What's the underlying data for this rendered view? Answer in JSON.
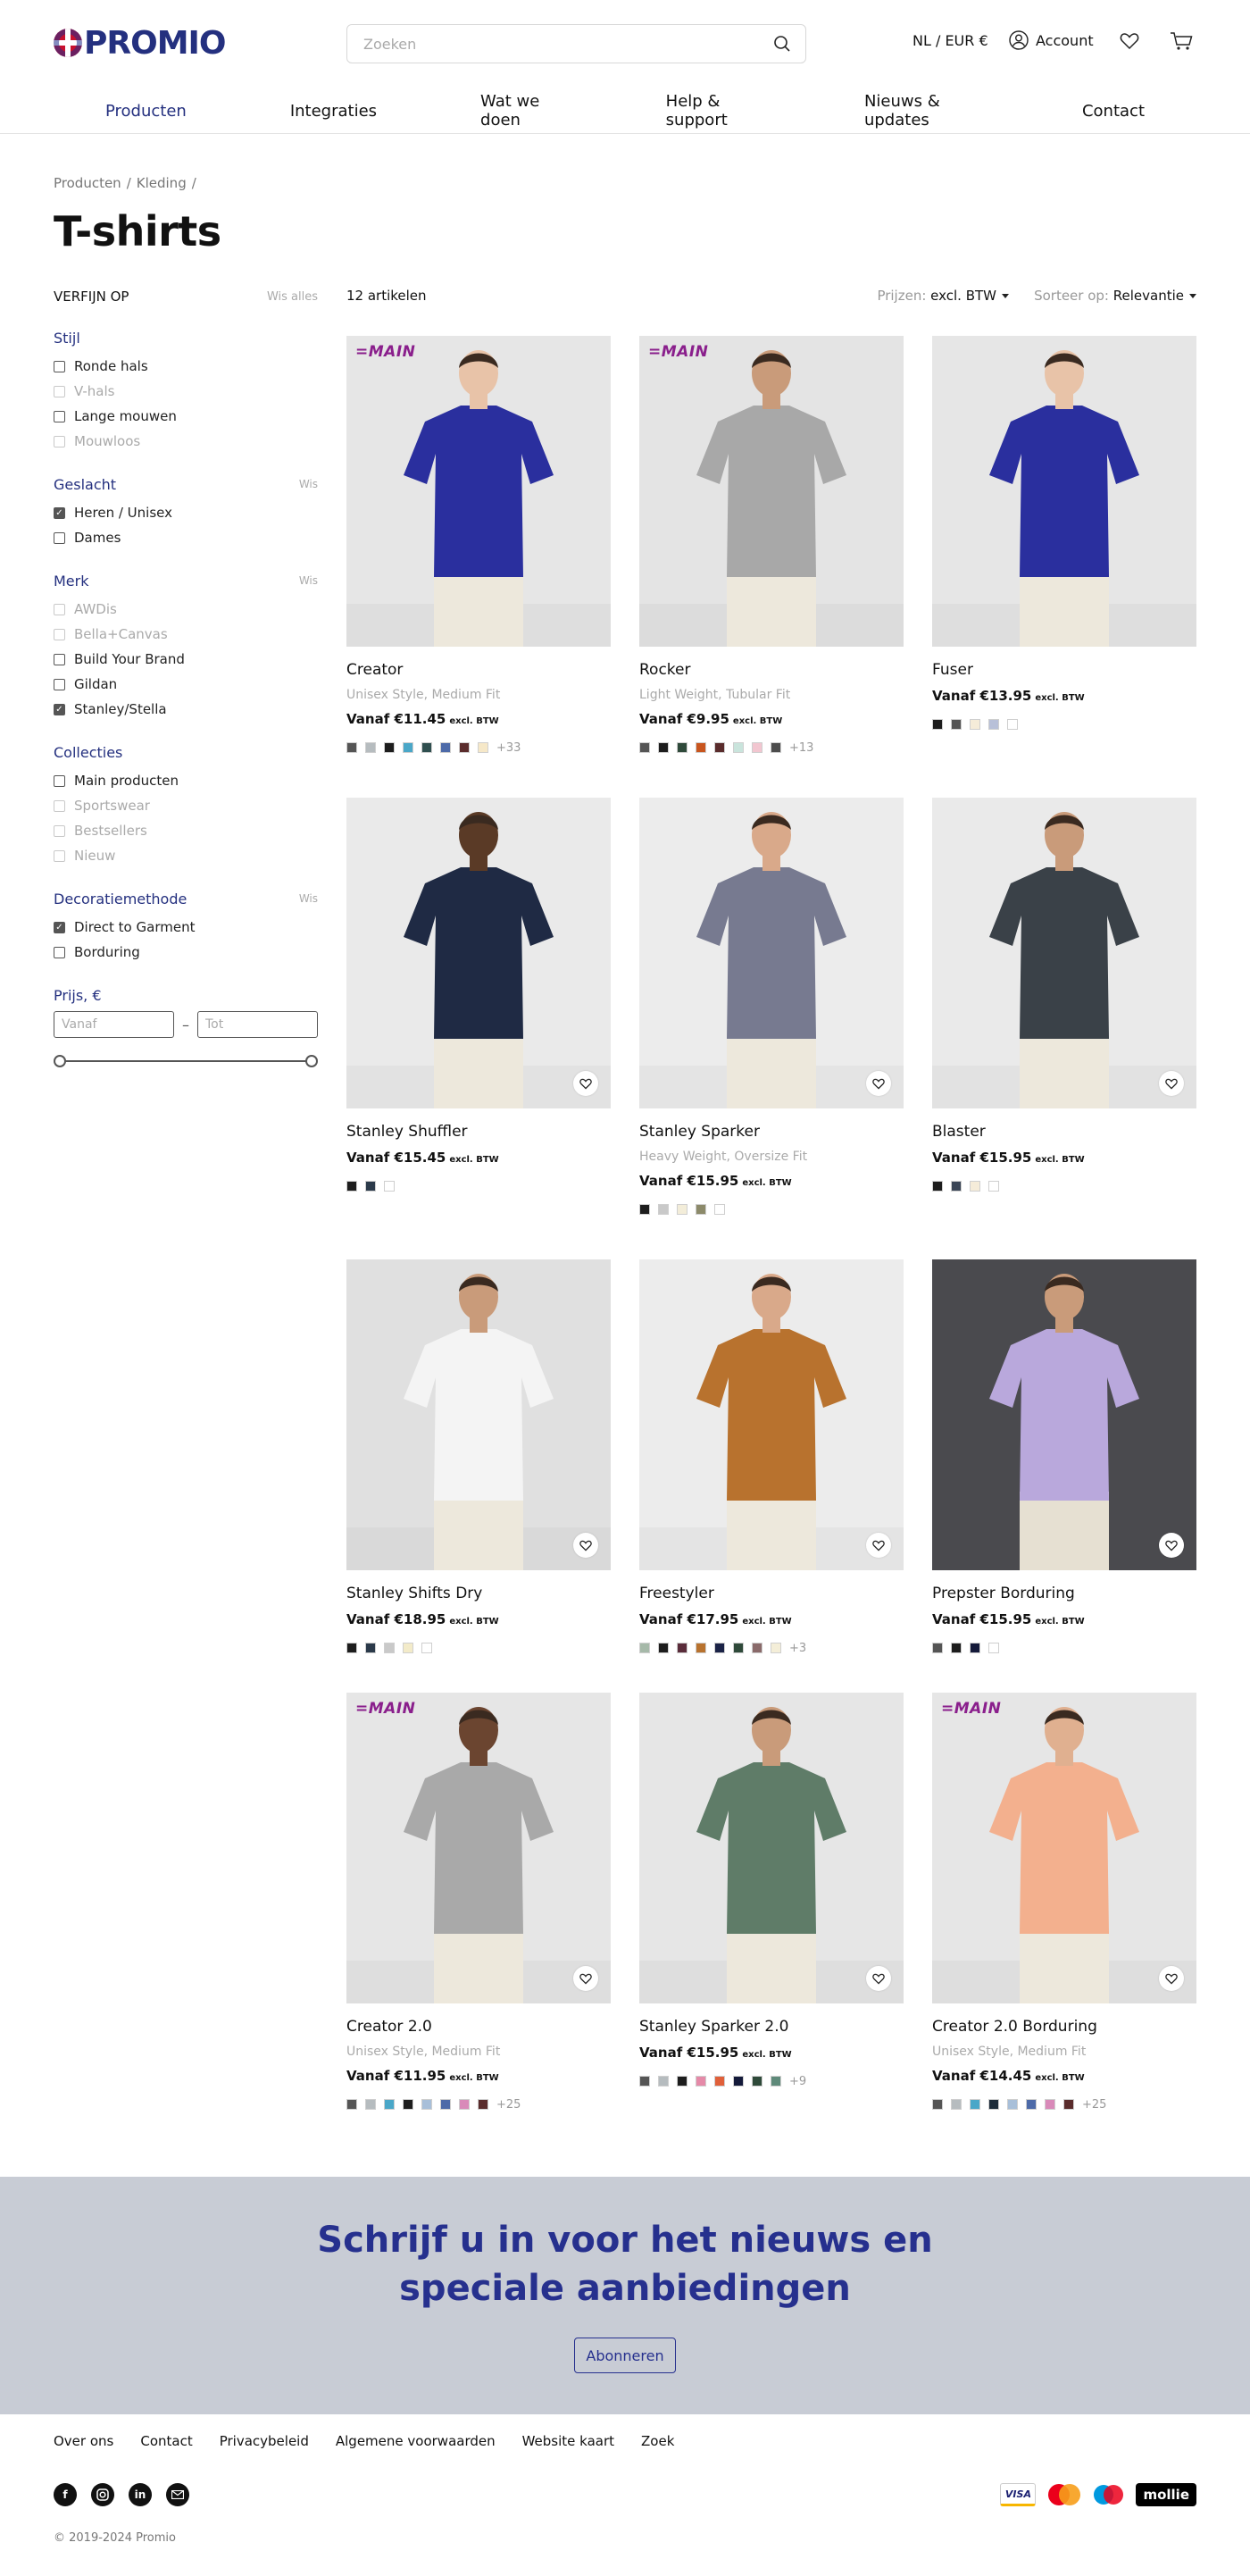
{
  "header": {
    "logo_text": "PROMIO",
    "search_placeholder": "Zoeken",
    "locale": "NL / EUR €",
    "account": "Account"
  },
  "nav": [
    "Producten",
    "Integraties",
    "Wat we doen",
    "Help & support",
    "Nieuws & updates",
    "Contact"
  ],
  "breadcrumb": [
    "Producten",
    "/",
    "Kleding",
    "/"
  ],
  "page_title": "T-shirts",
  "sidebar": {
    "heading": "VERFIJN OP",
    "clear_all": "Wis alles",
    "groups": [
      {
        "title": "Stijl",
        "clear": "",
        "options": [
          {
            "label": "Ronde hals",
            "checked": false,
            "disabled": false
          },
          {
            "label": "V-hals",
            "checked": false,
            "disabled": true
          },
          {
            "label": "Lange mouwen",
            "checked": false,
            "disabled": false
          },
          {
            "label": "Mouwloos",
            "checked": false,
            "disabled": true
          }
        ]
      },
      {
        "title": "Geslacht",
        "clear": "Wis",
        "options": [
          {
            "label": "Heren / Unisex",
            "checked": true,
            "disabled": false
          },
          {
            "label": "Dames",
            "checked": false,
            "disabled": false
          }
        ]
      },
      {
        "title": "Merk",
        "clear": "Wis",
        "options": [
          {
            "label": "AWDis",
            "checked": false,
            "disabled": true
          },
          {
            "label": "Bella+Canvas",
            "checked": false,
            "disabled": true
          },
          {
            "label": "Build Your Brand",
            "checked": false,
            "disabled": false
          },
          {
            "label": "Gildan",
            "checked": false,
            "disabled": false
          },
          {
            "label": "Stanley/Stella",
            "checked": true,
            "disabled": false
          }
        ]
      },
      {
        "title": "Collecties",
        "clear": "",
        "options": [
          {
            "label": "Main producten",
            "checked": false,
            "disabled": false
          },
          {
            "label": "Sportswear",
            "checked": false,
            "disabled": true
          },
          {
            "label": "Bestsellers",
            "checked": false,
            "disabled": true
          },
          {
            "label": "Nieuw",
            "checked": false,
            "disabled": true
          }
        ]
      },
      {
        "title": "Decoratiemethode",
        "clear": "Wis",
        "options": [
          {
            "label": "Direct to Garment",
            "checked": true,
            "disabled": false
          },
          {
            "label": "Borduring",
            "checked": false,
            "disabled": false
          }
        ]
      }
    ],
    "price": {
      "title": "Prijs, €",
      "from_placeholder": "Vanaf",
      "to_placeholder": "Tot",
      "dash": "–"
    }
  },
  "toolbar": {
    "count": "12 artikelen",
    "prices_label": "Prijzen:",
    "prices_value": "excl. BTW",
    "sort_label": "Sorteer op:",
    "sort_value": "Relevantie"
  },
  "products": [
    {
      "name": "Creator",
      "subtitle": "Unisex Style, Medium Fit",
      "price": "Vanaf €11.45",
      "tax": "excl. BTW",
      "badge": "=MAIN",
      "heart": false,
      "shirt": "#2a2f9e",
      "bg": "#e6e6e6",
      "skin": "#e8c3a8",
      "swatches": [
        "#555555",
        "#b6bcbf",
        "#1d1d1d",
        "#4aa7c8",
        "#2f4f4f",
        "#4d6aa8",
        "#5a2c2c",
        "#f6e8c8"
      ],
      "more": "+33"
    },
    {
      "name": "Rocker",
      "subtitle": "Light Weight, Tubular Fit",
      "price": "Vanaf €9.95",
      "tax": "excl. BTW",
      "badge": "=MAIN",
      "heart": false,
      "shirt": "#a8a8a8",
      "bg": "#e4e4e4",
      "skin": "#c99b7a",
      "swatches": [
        "#555555",
        "#1d1d1d",
        "#2f4a3a",
        "#c8551e",
        "#5a2c2c",
        "#c9e4dc",
        "#f2c6d0",
        "#4d4d4d"
      ],
      "more": "+13"
    },
    {
      "name": "Fuser",
      "subtitle": "",
      "price": "Vanaf €13.95",
      "tax": "excl. BTW",
      "badge": "",
      "heart": false,
      "shirt": "#2a2f9e",
      "bg": "#e6e6e6",
      "skin": "#e8c3a8",
      "swatches": [
        "#1d1d1d",
        "#555555",
        "#f5ecd9",
        "#b8c0d8",
        "#ffffff"
      ],
      "more": ""
    },
    {
      "name": "Stanley Shuffler",
      "subtitle": "",
      "price": "Vanaf €15.45",
      "tax": "excl. BTW",
      "badge": "",
      "heart": true,
      "shirt": "#1f2a44",
      "bg": "#eaeaea",
      "skin": "#5a3a26",
      "swatches": [
        "#1d1d1d",
        "#2b3a4a",
        "#ffffff"
      ],
      "more": ""
    },
    {
      "name": "Stanley Sparker",
      "subtitle": "Heavy Weight, Oversize Fit",
      "price": "Vanaf €15.95",
      "tax": "excl. BTW",
      "badge": "",
      "heart": true,
      "shirt": "#777a90",
      "bg": "#ececec",
      "skin": "#d9a98a",
      "swatches": [
        "#1d1d1d",
        "#c9c9c9",
        "#f3edd9",
        "#8c8a6a",
        "#ffffff"
      ],
      "more": ""
    },
    {
      "name": "Blaster",
      "subtitle": "",
      "price": "Vanaf €15.95",
      "tax": "excl. BTW",
      "badge": "",
      "heart": true,
      "shirt": "#3a4148",
      "bg": "#eaeaea",
      "skin": "#c99b7a",
      "swatches": [
        "#1d1d1d",
        "#3a4556",
        "#f5ecd9",
        "#ffffff"
      ],
      "more": ""
    },
    {
      "name": "Stanley Shifts Dry",
      "subtitle": "",
      "price": "Vanaf €18.95",
      "tax": "excl. BTW",
      "badge": "",
      "heart": true,
      "shirt": "#f4f4f4",
      "bg": "#e0e0e0",
      "skin": "#c99b7a",
      "swatches": [
        "#1d1d1d",
        "#2b3a4a",
        "#c9c9c9",
        "#f3ebc9",
        "#ffffff"
      ],
      "more": ""
    },
    {
      "name": "Freestyler",
      "subtitle": "",
      "price": "Vanaf €17.95",
      "tax": "excl. BTW",
      "badge": "",
      "heart": true,
      "shirt": "#b8722e",
      "bg": "#ececec",
      "skin": "#d9a98a",
      "swatches": [
        "#a6b9a9",
        "#1d1d1d",
        "#5a2c3a",
        "#b8722e",
        "#1b2347",
        "#2f4a3a",
        "#8a6a6a",
        "#f4eed8"
      ],
      "more": "+3"
    },
    {
      "name": "Prepster Borduring",
      "subtitle": "",
      "price": "Vanaf €15.95",
      "tax": "excl. BTW",
      "badge": "",
      "heart": true,
      "shirt": "#b9a8dc",
      "bg": "#4a4a4e",
      "skin": "#c99b7a",
      "swatches": [
        "#555555",
        "#1d1d1d",
        "#141a3a",
        "#ffffff"
      ],
      "more": ""
    },
    {
      "name": "Creator 2.0",
      "subtitle": "Unisex Style, Medium Fit",
      "price": "Vanaf €11.95",
      "tax": "excl. BTW",
      "badge": "=MAIN",
      "heart": true,
      "shirt": "#a9a9a9",
      "bg": "#e6e6e6",
      "skin": "#6b4530",
      "swatches": [
        "#555555",
        "#b6bcbf",
        "#4aa7c8",
        "#1d1d1d",
        "#a8bfd9",
        "#4d6aa8",
        "#d98ab9",
        "#5a2c2c"
      ],
      "more": "+25"
    },
    {
      "name": "Stanley Sparker 2.0",
      "subtitle": "",
      "price": "Vanaf €15.95",
      "tax": "excl. BTW",
      "badge": "",
      "heart": true,
      "shirt": "#5f7c68",
      "bg": "#e6e6e6",
      "skin": "#c99b7a",
      "swatches": [
        "#555555",
        "#b6bcbf",
        "#1d1d1d",
        "#e58aa8",
        "#e0603a",
        "#141a3a",
        "#2f4a3a",
        "#5f8a7a"
      ],
      "more": "+9"
    },
    {
      "name": "Creator 2.0 Borduring",
      "subtitle": "Unisex Style, Medium Fit",
      "price": "Vanaf €14.45",
      "tax": "excl. BTW",
      "badge": "=MAIN",
      "heart": true,
      "shirt": "#f3b08e",
      "bg": "#e6e6e6",
      "skin": "#e0b090",
      "swatches": [
        "#555555",
        "#b6bcbf",
        "#4aa7c8",
        "#1d2c3a",
        "#a8bfd9",
        "#4d6aa8",
        "#d98ab9",
        "#5a2c2c"
      ],
      "more": "+25"
    }
  ],
  "newsletter": {
    "title_line1": "Schrijf u in voor het nieuws en",
    "title_line2": "speciale aanbiedingen",
    "button": "Abonneren"
  },
  "footer": {
    "links": [
      "Over ons",
      "Contact",
      "Privacybeleid",
      "Algemene voorwaarden",
      "Website kaart",
      "Zoek"
    ],
    "social_icons": [
      "facebook-icon",
      "instagram-icon",
      "linkedin-icon",
      "email-icon"
    ],
    "payments": [
      "VISA",
      "mastercard",
      "maestro",
      "mollie"
    ],
    "copyright": "© 2019-2024 Promio"
  },
  "colors": {
    "brand": "#24307f",
    "newsletter_bg": "#c8ccd5"
  }
}
